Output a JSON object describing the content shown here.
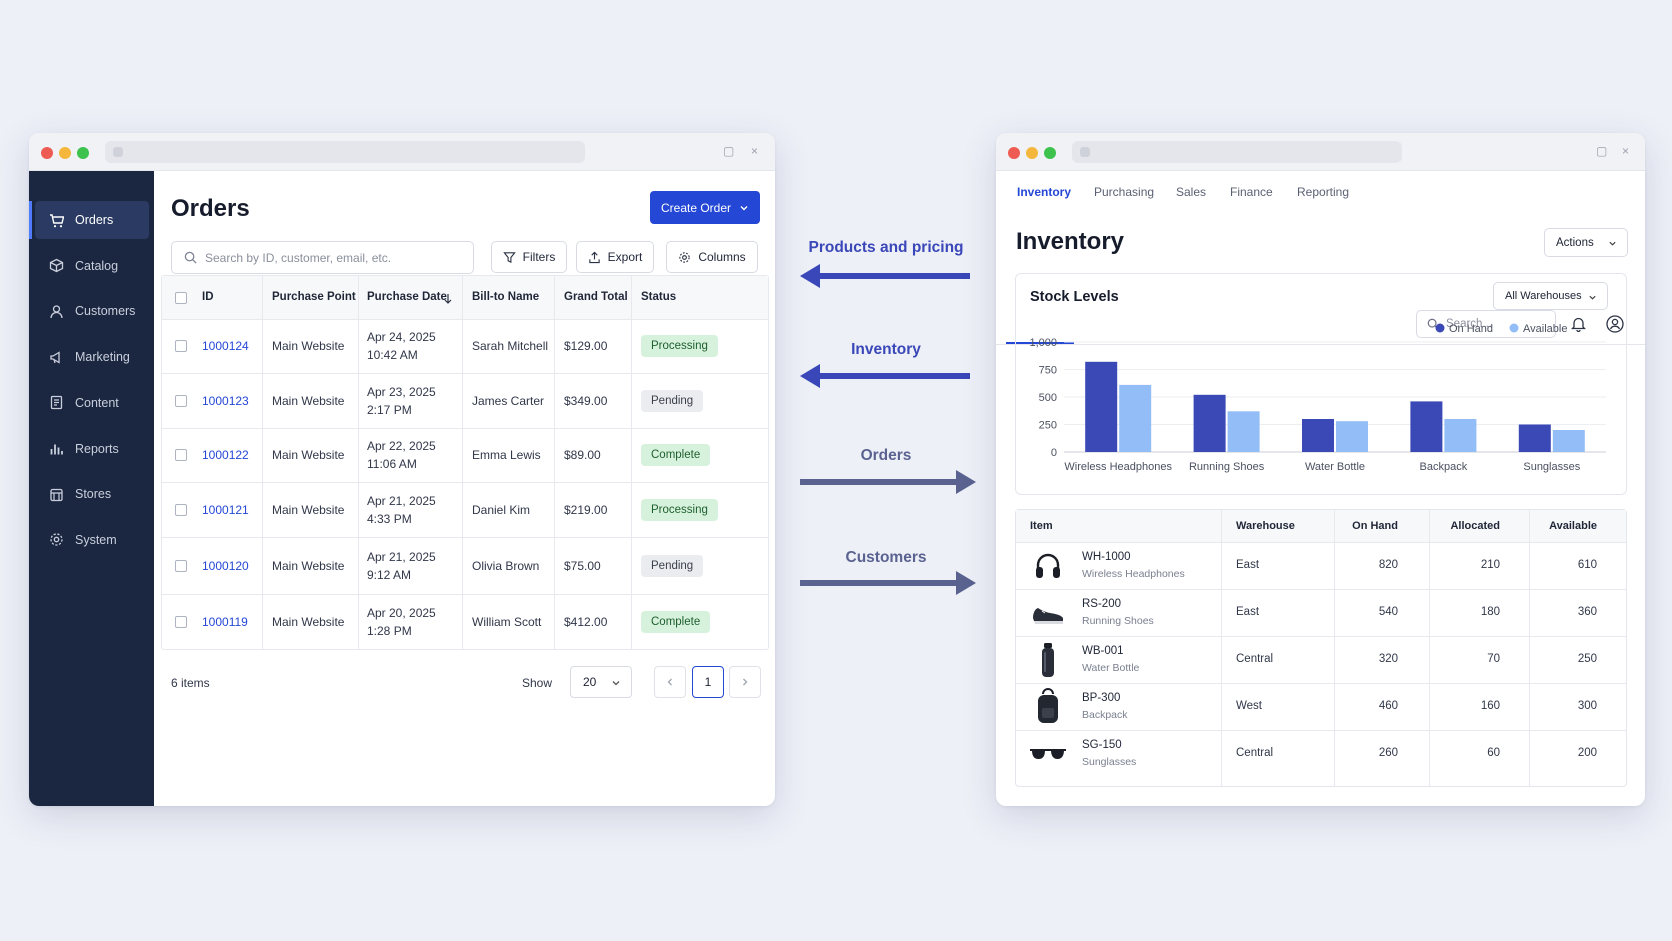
{
  "left_window": {
    "sidebar": [
      {
        "label": "Orders",
        "icon": "cart-icon",
        "active": true
      },
      {
        "label": "Catalog",
        "icon": "box-icon"
      },
      {
        "label": "Customers",
        "icon": "user-icon"
      },
      {
        "label": "Marketing",
        "icon": "megaphone-icon"
      },
      {
        "label": "Content",
        "icon": "document-icon"
      },
      {
        "label": "Reports",
        "icon": "bar-chart-icon"
      },
      {
        "label": "Stores",
        "icon": "store-icon"
      },
      {
        "label": "System",
        "icon": "gear-icon"
      }
    ],
    "page_title": "Orders",
    "create_button": "Create Order",
    "search_placeholder": "Search by ID, customer, email, etc.",
    "filters_label": "Filters",
    "export_label": "Export",
    "columns_label": "Columns",
    "columns": [
      "ID",
      "Purchase Point",
      "Purchase Date",
      "Bill-to Name",
      "Grand Total",
      "Status"
    ],
    "rows": [
      {
        "id": "1000124",
        "point": "Main Website",
        "date": "Apr 24, 2025",
        "time": "10:42 AM",
        "name": "Sarah Mitchell",
        "total": "$129.00",
        "status": "Processing"
      },
      {
        "id": "1000123",
        "point": "Main Website",
        "date": "Apr 23, 2025",
        "time": "2:17 PM",
        "name": "James Carter",
        "total": "$349.00",
        "status": "Pending"
      },
      {
        "id": "1000122",
        "point": "Main Website",
        "date": "Apr 22, 2025",
        "time": "11:06 AM",
        "name": "Emma Lewis",
        "total": "$89.00",
        "status": "Complete"
      },
      {
        "id": "1000121",
        "point": "Main Website",
        "date": "Apr 21, 2025",
        "time": "4:33 PM",
        "name": "Daniel Kim",
        "total": "$219.00",
        "status": "Processing"
      },
      {
        "id": "1000120",
        "point": "Main Website",
        "date": "Apr 21, 2025",
        "time": "9:12 AM",
        "name": "Olivia Brown",
        "total": "$75.00",
        "status": "Pending"
      },
      {
        "id": "1000119",
        "point": "Main Website",
        "date": "Apr 20, 2025",
        "time": "1:28 PM",
        "name": "William Scott",
        "total": "$412.00",
        "status": "Complete"
      }
    ],
    "item_count": "6 items",
    "show_label": "Show",
    "page_size": "20",
    "current_page": "1"
  },
  "arrows": [
    {
      "label": "Products and pricing",
      "direction": "left",
      "color": "#3947b8"
    },
    {
      "label": "Inventory",
      "direction": "left",
      "color": "#3947b8"
    },
    {
      "label": "Orders",
      "direction": "right",
      "color": "#5a6290"
    },
    {
      "label": "Customers",
      "direction": "right",
      "color": "#5a6290"
    }
  ],
  "right_window": {
    "tabs": [
      "Inventory",
      "Purchasing",
      "Sales",
      "Finance",
      "Reporting"
    ],
    "active_tab": "Inventory",
    "search_placeholder": "Search...",
    "page_title": "Inventory",
    "actions_label": "Actions",
    "chart_title": "Stock Levels",
    "warehouse_select": "All Warehouses",
    "table_columns": [
      "Item",
      "Warehouse",
      "On Hand",
      "Allocated",
      "Available"
    ],
    "items": [
      {
        "sku": "WH-1000",
        "name": "Wireless Headphones",
        "icon": "headphones-icon",
        "warehouse": "East",
        "on_hand": "820",
        "allocated": "210",
        "available": "610"
      },
      {
        "sku": "RS-200",
        "name": "Running Shoes",
        "icon": "shoe-icon",
        "warehouse": "East",
        "on_hand": "540",
        "allocated": "180",
        "available": "360"
      },
      {
        "sku": "WB-001",
        "name": "Water Bottle",
        "icon": "bottle-icon",
        "warehouse": "Central",
        "on_hand": "320",
        "allocated": "70",
        "available": "250"
      },
      {
        "sku": "BP-300",
        "name": "Backpack",
        "icon": "backpack-icon",
        "warehouse": "West",
        "on_hand": "460",
        "allocated": "160",
        "available": "300"
      },
      {
        "sku": "SG-150",
        "name": "Sunglasses",
        "icon": "sunglasses-icon",
        "warehouse": "Central",
        "on_hand": "260",
        "allocated": "60",
        "available": "200"
      }
    ]
  },
  "colors": {
    "accent": "#2447d6",
    "on_hand": "#3a49b6",
    "available": "#93bdf6",
    "sidebar": "#1b2640"
  },
  "chart_data": {
    "type": "bar",
    "title": "Stock Levels",
    "categories": [
      "Wireless Headphones",
      "Running Shoes",
      "Water Bottle",
      "Backpack",
      "Sunglasses"
    ],
    "series": [
      {
        "name": "On Hand",
        "values": [
          820,
          520,
          300,
          460,
          250
        ]
      },
      {
        "name": "Available",
        "values": [
          610,
          370,
          280,
          300,
          200
        ]
      }
    ],
    "y_ticks": [
      "0",
      "250",
      "500",
      "750",
      "1,000"
    ],
    "ylim": [
      0,
      1000
    ],
    "grid": true,
    "legend": "top-right"
  }
}
